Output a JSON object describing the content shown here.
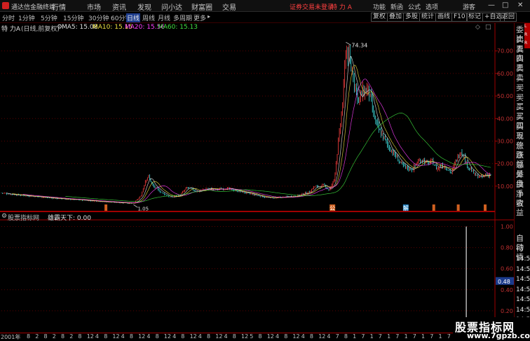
{
  "app": {
    "title": "通达信金融终端",
    "menu": [
      "行情",
      "市场",
      "资讯",
      "发现",
      "问小达",
      "财富圈",
      "交易"
    ],
    "status": "证券交易未登录",
    "stock_name": "特 力 A",
    "right_menu": [
      "功能",
      "新函",
      "公式",
      "选项"
    ],
    "user": "游客",
    "window_buttons": [
      "—",
      "□",
      "✕"
    ]
  },
  "periods": [
    "分时",
    "1分钟",
    "5分钟",
    "15分钟",
    "30分钟",
    "60分钟",
    "日线",
    "周线",
    "月线",
    "多周期",
    "更多"
  ],
  "active_period": "日线",
  "toolbar": [
    "复权",
    "叠加",
    "多股",
    "统计",
    "画线",
    "F10",
    "标记",
    "+自选",
    "返回"
  ],
  "main_panel": {
    "stock_label": "特 力A",
    "mode_label": "(日线,前复权)",
    "ma_items": [
      {
        "label": "MA5: 15.08",
        "color": "#e0e0e0"
      },
      {
        "label": "MA10: 15.15",
        "color": "#f0e040"
      },
      {
        "label": "MA20: 15.56",
        "color": "#ff40ff"
      },
      {
        "label": "MA60: 15.13",
        "color": "#40e040"
      }
    ],
    "y_ticks": [
      "70.00",
      "60.00",
      "50.00",
      "40.00",
      "30.00",
      "20.00",
      "10.00"
    ],
    "high_label": "74.34",
    "low_label": "1.05",
    "markers": [
      {
        "text": "公",
        "color": "#d06020"
      },
      {
        "text": "解",
        "color": "#2080c0"
      }
    ]
  },
  "sub_panel": {
    "indicator_name": "股票指标网",
    "formula_label": "雄霸天下: 0.00",
    "y_ticks": [
      "1.00",
      "0.80",
      "0.60",
      "0.40",
      "0.20"
    ],
    "current_value": "0.48"
  },
  "right_panel": {
    "labels": [
      "委比",
      "卖五",
      "卖四",
      "卖三",
      "卖二",
      "卖一",
      "买一",
      "买二",
      "买三",
      "买四",
      "买五",
      "现价",
      "涨跌",
      "涨幅",
      "总量",
      "外盘",
      "换手",
      "净资",
      "收益"
    ],
    "tab_label": "自动",
    "sub_label": "行情",
    "times": [
      "14:50",
      "14:50",
      "14:50",
      "14:50",
      "14:50",
      "14:50",
      "14:50",
      "14:50"
    ],
    "strip_letters": [
      "L",
      "R",
      "R"
    ]
  },
  "x_axis": {
    "start_label": "2001年",
    "months": [
      "8",
      "2",
      "8",
      "2",
      "8",
      "2",
      "8",
      "12",
      "4",
      "8",
      "12",
      "4",
      "8",
      "12",
      "4",
      "8",
      "12",
      "4",
      "8",
      "12",
      "4",
      "8",
      "12",
      "4",
      "8",
      "12",
      "5",
      "8",
      "12",
      "4",
      "8",
      "12",
      "4",
      "8",
      "12",
      "4",
      "7",
      "8",
      "1",
      "7",
      "1",
      "7",
      "1",
      "7",
      "1",
      "7",
      "1",
      "7",
      "1",
      "7",
      "1"
    ]
  },
  "watermark": {
    "title": "股票指标网",
    "url": "www.7gpzb.com"
  },
  "colors": {
    "rise": "#ff4040",
    "fall": "#40e0e0",
    "grid": "#5a0000",
    "axis": "#a00000",
    "highlight": "#1b3b8c"
  },
  "chart_data": {
    "type": "candlestick-line",
    "series_description": "Daily forward-adjusted closing price, 2001 onwards",
    "y_range": [
      0,
      78
    ],
    "points": [
      [
        0,
        7.0
      ],
      [
        3,
        6.2
      ],
      [
        6,
        5.6
      ],
      [
        9,
        5.0
      ],
      [
        12,
        4.4
      ],
      [
        15,
        4.0
      ],
      [
        18,
        3.6
      ],
      [
        21,
        3.1
      ],
      [
        24,
        2.7
      ],
      [
        27,
        2.4
      ],
      [
        28.5,
        5.5
      ],
      [
        29.5,
        13.0
      ],
      [
        30,
        14.5
      ],
      [
        31,
        10.0
      ],
      [
        32.5,
        7.5
      ],
      [
        34.5,
        5.0
      ],
      [
        36.5,
        6.0
      ],
      [
        38,
        9.5
      ],
      [
        40,
        7.5
      ],
      [
        42,
        9.0
      ],
      [
        44,
        8.5
      ],
      [
        46,
        9.0
      ],
      [
        48,
        8.0
      ],
      [
        50,
        7.0
      ],
      [
        52,
        6.0
      ],
      [
        54,
        5.0
      ],
      [
        56,
        4.8
      ],
      [
        58,
        5.2
      ],
      [
        60,
        5.6
      ],
      [
        62,
        6.8
      ],
      [
        63,
        7.5
      ],
      [
        64,
        10.0
      ],
      [
        65,
        9.5
      ],
      [
        66,
        10.5
      ],
      [
        67,
        8.0
      ],
      [
        68,
        13.0
      ],
      [
        69,
        32.0
      ],
      [
        69.8,
        48.0
      ],
      [
        70.4,
        72.0
      ],
      [
        71,
        66.0
      ],
      [
        72,
        58.0
      ],
      [
        73,
        48.0
      ],
      [
        74,
        52.0
      ],
      [
        75,
        53.0
      ],
      [
        76,
        42.0
      ],
      [
        77,
        35.0
      ],
      [
        78,
        32.0
      ],
      [
        79,
        28.0
      ],
      [
        80,
        25.0
      ],
      [
        81,
        22.0
      ],
      [
        82,
        19.0
      ],
      [
        83,
        18.0
      ],
      [
        84,
        17.5
      ],
      [
        85,
        20.5
      ],
      [
        86,
        22.0
      ],
      [
        87,
        20.0
      ],
      [
        88,
        21.0
      ],
      [
        89,
        17.5
      ],
      [
        90,
        19.5
      ],
      [
        91,
        18.0
      ],
      [
        92,
        16.0
      ],
      [
        93,
        22.0
      ],
      [
        94,
        26.0
      ],
      [
        95,
        20.0
      ],
      [
        96,
        17.0
      ],
      [
        97,
        14.5
      ],
      [
        98,
        14.0
      ],
      [
        99,
        15.0
      ],
      [
        100,
        15.08
      ]
    ],
    "indicator": {
      "name": "雄霸天下",
      "y_range": [
        0,
        1.05
      ],
      "spike_value": 1.0
    }
  }
}
